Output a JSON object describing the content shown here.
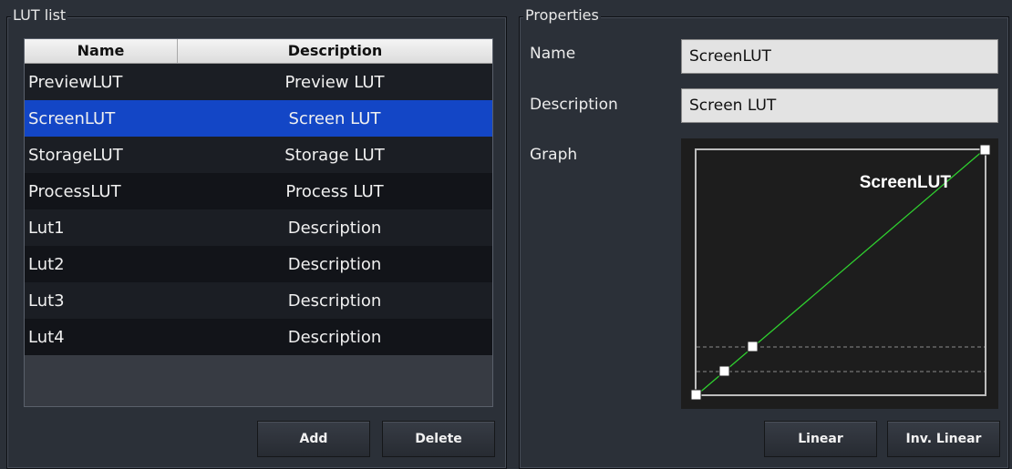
{
  "lut_list": {
    "title": "LUT list",
    "columns": [
      "Name",
      "Description"
    ],
    "rows": [
      {
        "name": "PreviewLUT",
        "description": "Preview LUT"
      },
      {
        "name": "ScreenLUT",
        "description": "Screen LUT"
      },
      {
        "name": "StorageLUT",
        "description": "Storage LUT"
      },
      {
        "name": "ProcessLUT",
        "description": "Process LUT"
      },
      {
        "name": "Lut1",
        "description": "Description"
      },
      {
        "name": "Lut2",
        "description": "Description"
      },
      {
        "name": "Lut3",
        "description": "Description"
      },
      {
        "name": "Lut4",
        "description": "Description"
      }
    ],
    "selected_index": 1,
    "add_label": "Add",
    "delete_label": "Delete"
  },
  "properties": {
    "title": "Properties",
    "name_label": "Name",
    "name_value": "ScreenLUT",
    "description_label": "Description",
    "description_value": "Screen LUT",
    "graph_label": "Graph",
    "graph_title": "ScreenLUT",
    "linear_label": "Linear",
    "inv_linear_label": "Inv. Linear"
  },
  "colors": {
    "selection": "#1346c6",
    "curve": "#2fd02f"
  }
}
